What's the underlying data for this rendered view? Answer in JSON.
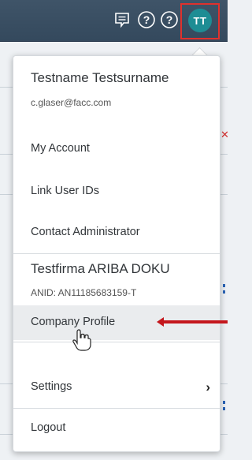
{
  "header": {
    "icons": [
      "feedback-icon",
      "help-icon",
      "help-icon"
    ],
    "avatar_initials": "TT"
  },
  "user_menu": {
    "user_name": "Testname Testsurname",
    "user_email": "c.glaser@facc.com",
    "items_top": [
      "My Account",
      "Link User IDs",
      "Contact Administrator"
    ],
    "company_name": "Testfirma ARIBA DOKU",
    "anid": "ANID: AN11185683159-T",
    "company_profile": "Company Profile",
    "settings": "Settings",
    "logout": "Logout"
  },
  "colors": {
    "topbar": "#3f5468",
    "avatar": "#1e8d94",
    "highlight_border": "#e0312d",
    "annotation_arrow": "#c4161c"
  }
}
